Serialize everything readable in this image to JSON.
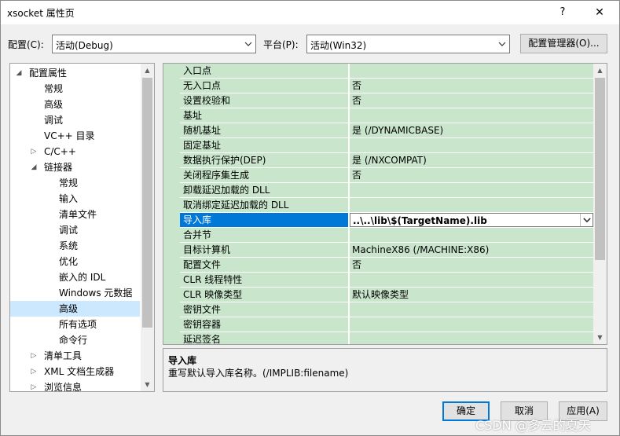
{
  "window": {
    "title": "xsocket 属性页",
    "help": "?",
    "close": "✕"
  },
  "config_bar": {
    "config_label": "配置(C):",
    "config_value": "活动(Debug)",
    "platform_label": "平台(P):",
    "platform_value": "活动(Win32)",
    "manager_button": "配置管理器(O)..."
  },
  "tree": {
    "items": [
      {
        "label": "配置属性",
        "expanded": true
      },
      {
        "label": "常规"
      },
      {
        "label": "高级"
      },
      {
        "label": "调试"
      },
      {
        "label": "VC++ 目录"
      },
      {
        "label": "C/C++",
        "expanded": false
      },
      {
        "label": "链接器",
        "expanded": true
      },
      {
        "label": "常规"
      },
      {
        "label": "输入"
      },
      {
        "label": "清单文件"
      },
      {
        "label": "调试"
      },
      {
        "label": "系统"
      },
      {
        "label": "优化"
      },
      {
        "label": "嵌入的 IDL"
      },
      {
        "label": "Windows 元数据"
      },
      {
        "label": "高级",
        "selected": true
      },
      {
        "label": "所有选项"
      },
      {
        "label": "命令行"
      },
      {
        "label": "清单工具",
        "expanded": false
      },
      {
        "label": "XML 文档生成器",
        "expanded": false
      },
      {
        "label": "浏览信息",
        "expanded": false
      }
    ]
  },
  "properties": [
    {
      "name": "入口点",
      "value": ""
    },
    {
      "name": "无入口点",
      "value": "否"
    },
    {
      "name": "设置校验和",
      "value": "否"
    },
    {
      "name": "基址",
      "value": ""
    },
    {
      "name": "随机基址",
      "value": "是 (/DYNAMICBASE)"
    },
    {
      "name": "固定基址",
      "value": ""
    },
    {
      "name": "数据执行保护(DEP)",
      "value": "是 (/NXCOMPAT)"
    },
    {
      "name": "关闭程序集生成",
      "value": "否"
    },
    {
      "name": "卸载延迟加载的 DLL",
      "value": ""
    },
    {
      "name": "取消绑定延迟加载的 DLL",
      "value": ""
    },
    {
      "name": "导入库",
      "value": "..\\..\\lib\\$(TargetName).lib",
      "selected": true
    },
    {
      "name": "合并节",
      "value": ""
    },
    {
      "name": "目标计算机",
      "value": "MachineX86 (/MACHINE:X86)"
    },
    {
      "name": "配置文件",
      "value": "否"
    },
    {
      "name": "CLR 线程特性",
      "value": ""
    },
    {
      "name": "CLR 映像类型",
      "value": "默认映像类型"
    },
    {
      "name": "密钥文件",
      "value": ""
    },
    {
      "name": "密钥容器",
      "value": ""
    },
    {
      "name": "延迟签名",
      "value": ""
    }
  ],
  "description": {
    "title": "导入库",
    "text": "重写默认导入库名称。(/IMPLIB:filename)"
  },
  "buttons": {
    "ok": "确定",
    "cancel": "取消",
    "apply": "应用(A)"
  },
  "watermark": "CSDN @多云的夏天",
  "colors": {
    "grid_bg": "#c9e6cc",
    "selection": "#0078d7",
    "tree_selection": "#cce8ff"
  }
}
